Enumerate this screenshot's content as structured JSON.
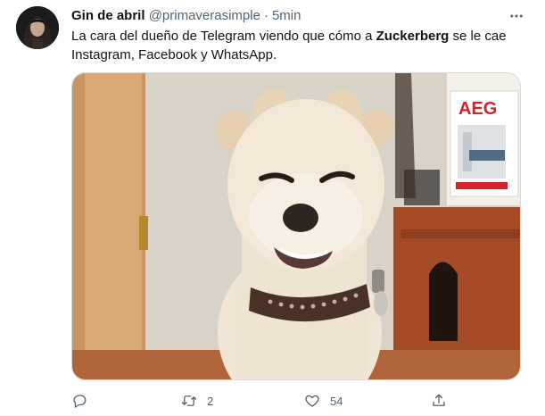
{
  "tweet": {
    "author_name": "Gin de abril",
    "author_handle": "@primaverasimple",
    "separator": "·",
    "timestamp": "5min",
    "text_before": "La cara del dueño de Telegram viendo que cómo a ",
    "text_bold": "Zuckerberg",
    "text_after": " se le cae Instagram, Facebook y WhatsApp.",
    "image_text": "AEG",
    "image_alt": "Smiling dog wearing a studded collar"
  },
  "actions": {
    "reply_count": "",
    "retweet_count": "2",
    "like_count": "54"
  },
  "icons": {
    "more": "more-horizontal-icon",
    "reply": "reply-icon",
    "retweet": "retweet-icon",
    "like": "heart-icon",
    "share": "share-icon"
  },
  "colors": {
    "text_primary": "#0f1419",
    "text_secondary": "#536471",
    "border": "#cfd9de",
    "brand_red": "#d2232a"
  }
}
